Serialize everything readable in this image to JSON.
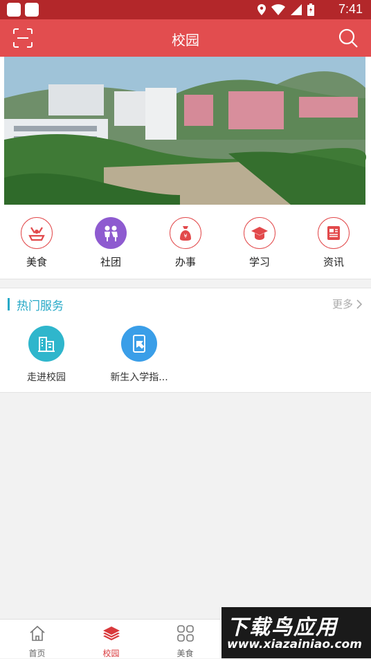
{
  "status_bar": {
    "time": "7:41"
  },
  "header": {
    "title": "校园"
  },
  "categories": [
    {
      "label": "美食",
      "icon": "food-icon",
      "color": "#e2494b"
    },
    {
      "label": "社团",
      "icon": "club-icon",
      "color": "#8e5bd0"
    },
    {
      "label": "办事",
      "icon": "money-bag-icon",
      "color": "#e2494b"
    },
    {
      "label": "学习",
      "icon": "graduation-cap-icon",
      "color": "#e2494b"
    },
    {
      "label": "资讯",
      "icon": "news-icon",
      "color": "#e2494b"
    }
  ],
  "hot_services": {
    "title": "热门服务",
    "more": "更多",
    "items": [
      {
        "label": "走进校园",
        "icon": "campus-building-icon",
        "color": "#2fb6cc"
      },
      {
        "label": "新生入学指...",
        "icon": "tablet-guide-icon",
        "color": "#3a9ee8"
      }
    ]
  },
  "tabbar": {
    "items": [
      {
        "label": "首页",
        "icon": "home-icon"
      },
      {
        "label": "校园",
        "icon": "layers-icon",
        "active": true
      },
      {
        "label": "美食",
        "icon": "grid-icon"
      }
    ]
  },
  "watermark": {
    "line1": "下载鸟应用",
    "line2": "www.xiazainiao.com"
  },
  "accent_color": "#e24d4f",
  "status_color": "#b3272a"
}
